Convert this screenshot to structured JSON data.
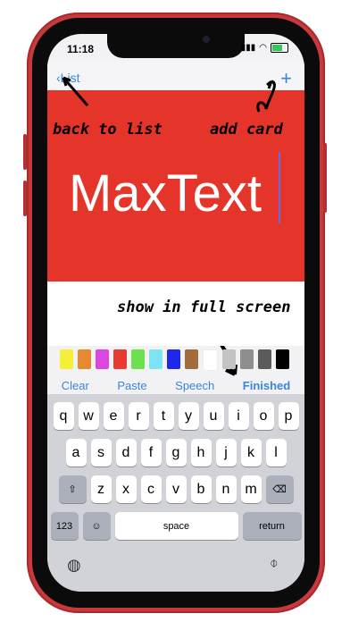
{
  "status_bar": {
    "time": "11:18"
  },
  "nav": {
    "back_label": "List",
    "add_label": "+"
  },
  "card": {
    "text": "MaxText",
    "background": "#e5342a"
  },
  "annotations": {
    "back": "back to list",
    "add": "add card",
    "fullscreen": "show in full screen"
  },
  "colors": [
    "#f6ef3a",
    "#e6892f",
    "#dd46e1",
    "#e63b2e",
    "#6be14e",
    "#7ee3f3",
    "#1d28e8",
    "#a56c3b",
    "#ffffff",
    "#c4c4c4",
    "#8e8e8e",
    "#5b5b5b",
    "#000000"
  ],
  "toolbar": {
    "clear": "Clear",
    "paste": "Paste",
    "speech": "Speech",
    "finished": "Finished"
  },
  "keyboard": {
    "row1": [
      "q",
      "w",
      "e",
      "r",
      "t",
      "y",
      "u",
      "i",
      "o",
      "p"
    ],
    "row2": [
      "a",
      "s",
      "d",
      "f",
      "g",
      "h",
      "j",
      "k",
      "l"
    ],
    "row3": [
      "z",
      "x",
      "c",
      "v",
      "b",
      "n",
      "m"
    ],
    "numbers": "123",
    "space": "space",
    "return": "return"
  }
}
